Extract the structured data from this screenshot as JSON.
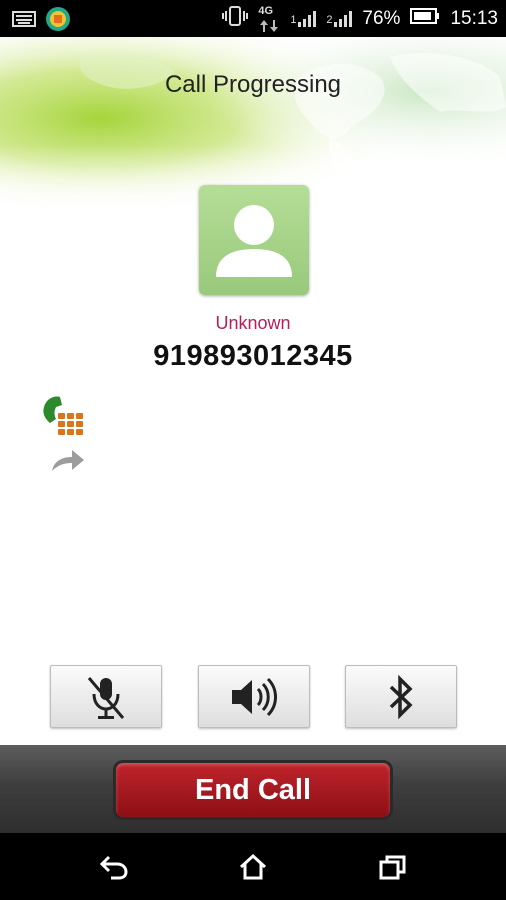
{
  "status_bar": {
    "battery_percent": "76%",
    "time": "15:13",
    "network_type": "4G",
    "sim1_label": "1",
    "sim2_label": "2",
    "icons": [
      "keyboard-icon",
      "app-notification-icon",
      "vibrate-icon",
      "network-4g-icon",
      "signal-sim1-icon",
      "signal-sim2-icon",
      "battery-icon"
    ]
  },
  "call": {
    "title": "Call Progressing",
    "contact_name": "Unknown",
    "number": "919893012345"
  },
  "side_icons": [
    "dialpad-call-icon",
    "forward-arrow-icon"
  ],
  "controls": [
    {
      "name": "mute-button",
      "icon": "mic-muted-icon"
    },
    {
      "name": "speaker-button",
      "icon": "speaker-icon"
    },
    {
      "name": "bluetooth-button",
      "icon": "bluetooth-icon"
    }
  ],
  "end_call": {
    "label": "End Call"
  },
  "nav": [
    "back-icon",
    "home-icon",
    "recents-icon"
  ],
  "colors": {
    "contact_name": "#b0205a",
    "end_call": "#a8171e",
    "avatar": "#a8d48a"
  }
}
